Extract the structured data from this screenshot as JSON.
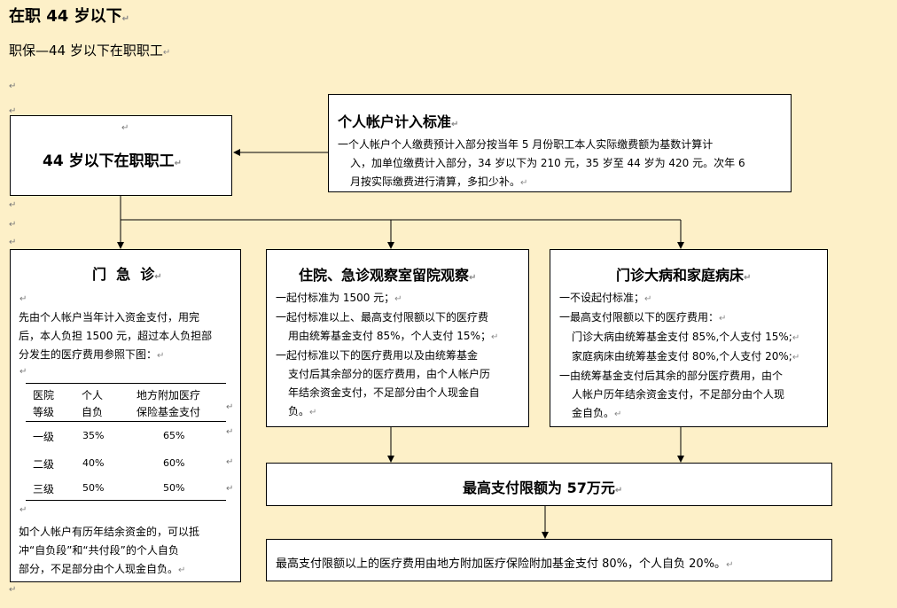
{
  "header": {
    "title": "在职 44 岁以下",
    "subtitle": "职保—44 岁以下在职职工"
  },
  "mark": "↵",
  "main_box": {
    "title": "44 岁以下在职职工"
  },
  "account": {
    "title": "个人帐户计入标准",
    "line1": "一个人帐户个人缴费预计入部分按当年 5 月份职工本人实际缴费额为基数计算计",
    "line2": "入，加单位缴费计入部分，34 岁以下为 210 元，35 岁至 44 岁为 420 元。次年 6",
    "line3": "月按实际缴费进行清算，多扣少补。"
  },
  "outpatient": {
    "title": "门  急  诊",
    "p1": "先由个人帐户当年计入资金支付，用完",
    "p2": "后，本人负担 1500 元，超过本人负担部",
    "p3": "分发生的医疗费用参照下图：",
    "table": {
      "h1a": "医院",
      "h1b": "等级",
      "h2a": "个人",
      "h2b": "自负",
      "h3a": "地方附加医疗",
      "h3b": "保险基金支付",
      "rows": [
        {
          "level": "一级",
          "self": "35%",
          "fund": "65%"
        },
        {
          "level": "二级",
          "self": "40%",
          "fund": "60%"
        },
        {
          "level": "三级",
          "self": "50%",
          "fund": "50%"
        }
      ]
    },
    "q1": "如个人帐户有历年结余资金的，可以抵",
    "q2": "冲“自负段”和“共付段”的个人自负",
    "q3": "部分，不足部分由个人现金自负。"
  },
  "inpatient": {
    "title": "住院、急诊观察室留院观察",
    "l1": "一起付标准为 1500 元；",
    "l2": "一起付标准以上、最高支付限额以下的医疗费",
    "l3": "用由统筹基金支付 85%，个人支付 15%；",
    "l4": "一起付标准以下的医疗费用以及由统筹基金",
    "l5": "支付后其余部分的医疗费用，由个人帐户历",
    "l6": "年结余资金支付，不足部分由个人现金自",
    "l7": "负。"
  },
  "serious": {
    "title": "门诊大病和家庭病床",
    "l1": "一不设起付标准；",
    "l2": "一最高支付限额以下的医疗费用：",
    "l3": "门诊大病由统筹基金支付 85%,个人支付 15%;",
    "l4": "家庭病床由统筹基金支付 80%,个人支付 20%;",
    "l5": "一由统筹基金支付后其余的部分医疗费用，由个",
    "l6": "人帐户历年结余资金支付，不足部分由个人现",
    "l7": "金自负。"
  },
  "limit": {
    "text": "最高支付限额为 57万元"
  },
  "above": {
    "text": "最高支付限额以上的医疗费用由地方附加医疗保险附加基金支付 80%，个人自负 20%。"
  }
}
